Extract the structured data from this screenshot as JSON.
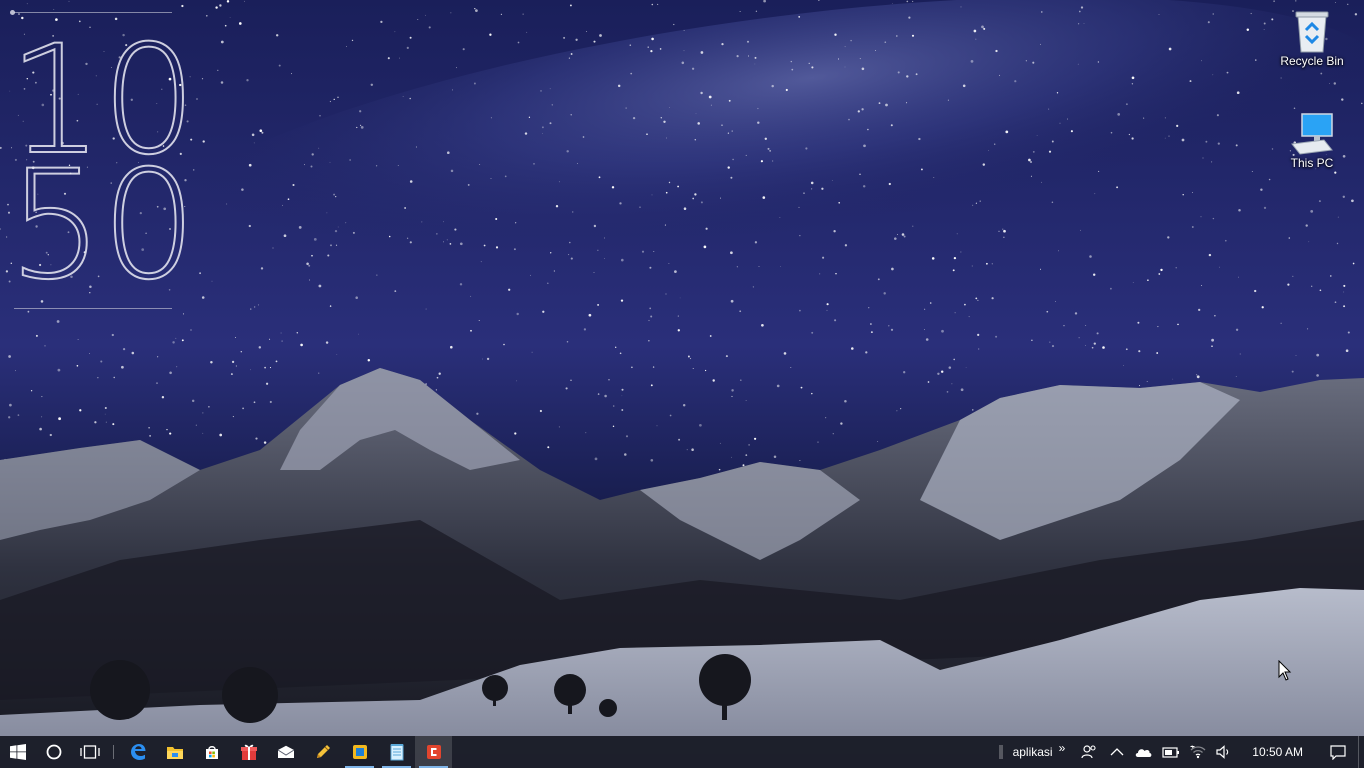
{
  "desktop": {
    "clock_widget": {
      "hours": "10",
      "minutes": "50"
    },
    "icons": [
      {
        "label": "Recycle Bin",
        "icon": "recycle-bin-icon"
      },
      {
        "label": "This PC",
        "icon": "this-pc-icon"
      }
    ]
  },
  "taskbar": {
    "start": {
      "icon": "windows-logo-icon"
    },
    "search": {
      "icon": "cortana-circle-icon"
    },
    "task_view": {
      "icon": "task-view-icon"
    },
    "pinned_apps": [
      {
        "name": "edge",
        "icon": "edge-icon"
      },
      {
        "name": "file-explorer",
        "icon": "folder-icon"
      },
      {
        "name": "store",
        "icon": "store-bag-icon"
      },
      {
        "name": "gift-app",
        "icon": "gift-icon"
      },
      {
        "name": "mail",
        "icon": "mail-icon"
      },
      {
        "name": "pencil-app",
        "icon": "pencil-icon"
      },
      {
        "name": "yellow-app",
        "icon": "square-app-icon"
      },
      {
        "name": "notepad",
        "icon": "notepad-icon"
      },
      {
        "name": "red-app",
        "icon": "red-square-icon"
      }
    ],
    "toolbar_label": "aplikasi",
    "toolbar_chevron": "»",
    "tray": {
      "clock": "10:50 AM",
      "icons": [
        "people-icon",
        "show-hidden-chevron-icon",
        "onedrive-cloud-icon",
        "battery-icon",
        "wifi-icon",
        "volume-icon",
        "action-center-icon"
      ]
    }
  },
  "colors": {
    "taskbar_bg": "#16182299",
    "accent": "#7fb4e8"
  }
}
